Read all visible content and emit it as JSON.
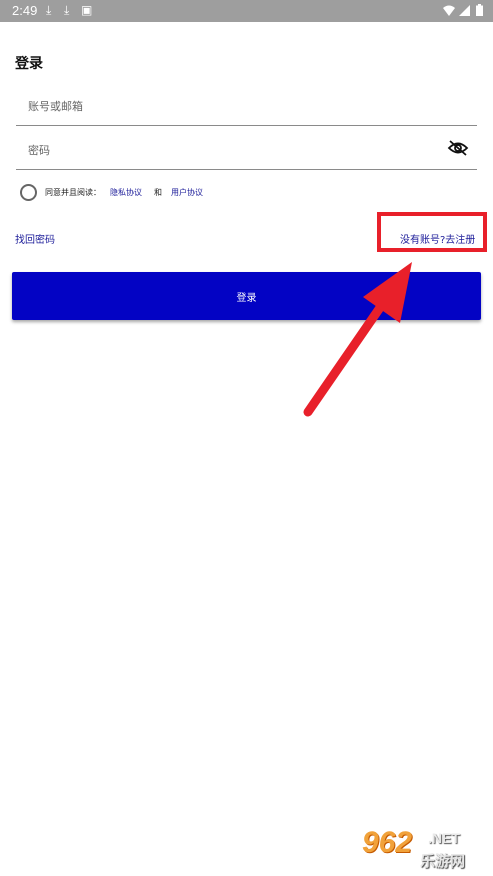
{
  "status_bar": {
    "time": "2:49",
    "icons_left": [
      "download-icon",
      "download-icon",
      "image-icon"
    ],
    "icons_right": [
      "wifi-icon",
      "signal-icon",
      "battery-icon"
    ]
  },
  "page": {
    "title": "登录"
  },
  "form": {
    "account_placeholder": "账号或邮箱",
    "password_placeholder": "密码",
    "password_toggle_icon": "eye-off-icon"
  },
  "agreement": {
    "prefix": "同意并且阅读：",
    "privacy_link": "隐私协议",
    "conjunction": "和",
    "user_link": "用户协议"
  },
  "links": {
    "forgot_password": "找回密码",
    "register": "没有账号?去注册"
  },
  "login_button": "登录",
  "watermark": {
    "main": "962",
    "suffix": ".NET",
    "sub": "乐游网"
  },
  "colors": {
    "primary": "#0303c4",
    "link": "#1d1d9a",
    "annotation": "#e8202a",
    "status_bar": "#9e9e9e"
  }
}
